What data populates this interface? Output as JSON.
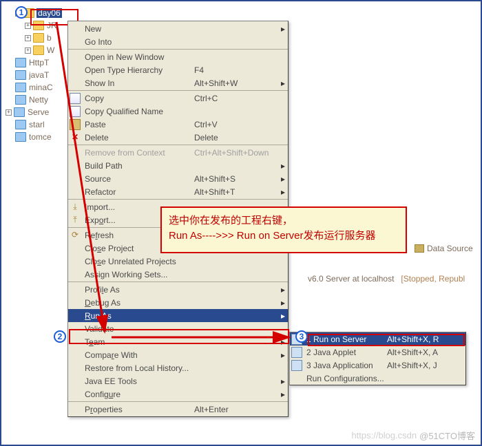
{
  "markers": {
    "m1": "1",
    "m2": "2",
    "m3": "3"
  },
  "tree": {
    "sel": "day06",
    "items": [
      "JR",
      "b",
      "W",
      "HttpT",
      "javaT",
      "minaC",
      "Netty",
      "Serve",
      "starl",
      "tomce"
    ]
  },
  "ctx": {
    "new": "New",
    "goInto": "Go Into",
    "openNewWin": "Open in New Window",
    "openTypeH": "Open Type Hierarchy",
    "openTypeH_k": "F4",
    "showIn": "Show In",
    "showIn_k": "Alt+Shift+W",
    "copy": "Copy",
    "copy_k": "Ctrl+C",
    "copyQ": "Copy Qualified Name",
    "paste": "Paste",
    "paste_k": "Ctrl+V",
    "delete": "Delete",
    "delete_k": "Delete",
    "removeCtx": "Remove from Context",
    "removeCtx_k": "Ctrl+Alt+Shift+Down",
    "buildPath": "Build Path",
    "source": "Source",
    "source_k": "Alt+Shift+S",
    "refactor": "Refactor",
    "refactor_k": "Alt+Shift+T",
    "import": "Import...",
    "export": "Export...",
    "refresh": "Refresh",
    "closeProj": "Close Project",
    "closeUnrel": "Close Unrelated Projects",
    "assignWS": "Assign Working Sets...",
    "profileAs": "Profile As",
    "debugAs": "Debug As",
    "runAs": "Run As",
    "validate": "Validate",
    "team": "Team",
    "compareWith": "Compare With",
    "restoreLH": "Restore from Local History...",
    "javaEE": "Java EE Tools",
    "configure": "Configure",
    "properties": "Properties",
    "properties_k": "Alt+Enter"
  },
  "sub": {
    "runServer": "1 Run on Server",
    "runServer_k": "Alt+Shift+X, R",
    "javaApplet": "2 Java Applet",
    "javaApplet_k": "Alt+Shift+X, A",
    "javaApp": "3 Java Application",
    "javaApp_k": "Alt+Shift+X, J",
    "runConfig": "Run Configurations..."
  },
  "callout": {
    "l1": "选中你在发布的工程右键，",
    "l2": "Run As---->>> Run on Server发布运行服务器"
  },
  "server": {
    "label": "v6.0 Server at localhost",
    "state": "[Stopped, Republ"
  },
  "dataSource": "Data Source",
  "watermark": {
    "a": "https://blog.csdn",
    "b": "@51CTO博客"
  }
}
